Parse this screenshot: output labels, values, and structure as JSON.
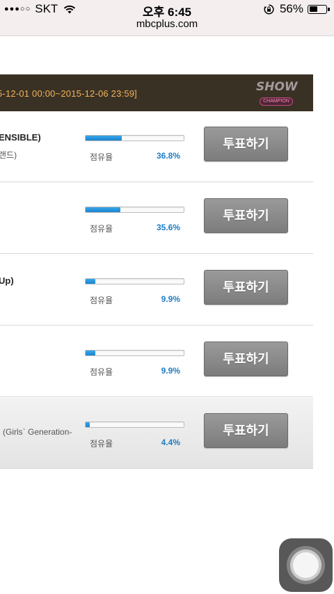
{
  "status_bar": {
    "signal": "●●●○○",
    "carrier": "SKT",
    "time": "오후 6:45",
    "battery_percent": "56%",
    "battery_level": 0.56
  },
  "url_bar": {
    "url": "mbcplus.com"
  },
  "vote_period": {
    "text": "5-12-01 00:00~2015-12-06 23:59]",
    "logo_main": "SHOW",
    "logo_sub": "CHAMPION"
  },
  "colors": {
    "banner_bg": "#3a3125",
    "banner_text": "#f3b35a",
    "bar_fill": "#1f8ad6",
    "share_value": "#1f7dc4",
    "vote_button": "#8a8a8a"
  },
  "candidates": [
    {
      "title": "ENSIBLE)",
      "artist": "랜드)",
      "share_label": "점유율",
      "share_value": "36.8%",
      "share": 36.8,
      "vote_label": "투표하기"
    },
    {
      "title": "",
      "artist": "",
      "share_label": "점유율",
      "share_value": "35.6%",
      "share": 35.6,
      "vote_label": "투표하기"
    },
    {
      "title": "Up)",
      "artist": "",
      "share_label": "점유율",
      "share_value": "9.9%",
      "share": 9.9,
      "vote_label": "투표하기"
    },
    {
      "title": "",
      "artist": "",
      "share_label": "점유율",
      "share_value": "9.9%",
      "share": 9.9,
      "vote_label": "투표하기"
    },
    {
      "title": "",
      "artist": "l (Girls` Generation-",
      "share_label": "점유율",
      "share_value": "4.4%",
      "share": 4.4,
      "vote_label": "투표하기"
    }
  ]
}
